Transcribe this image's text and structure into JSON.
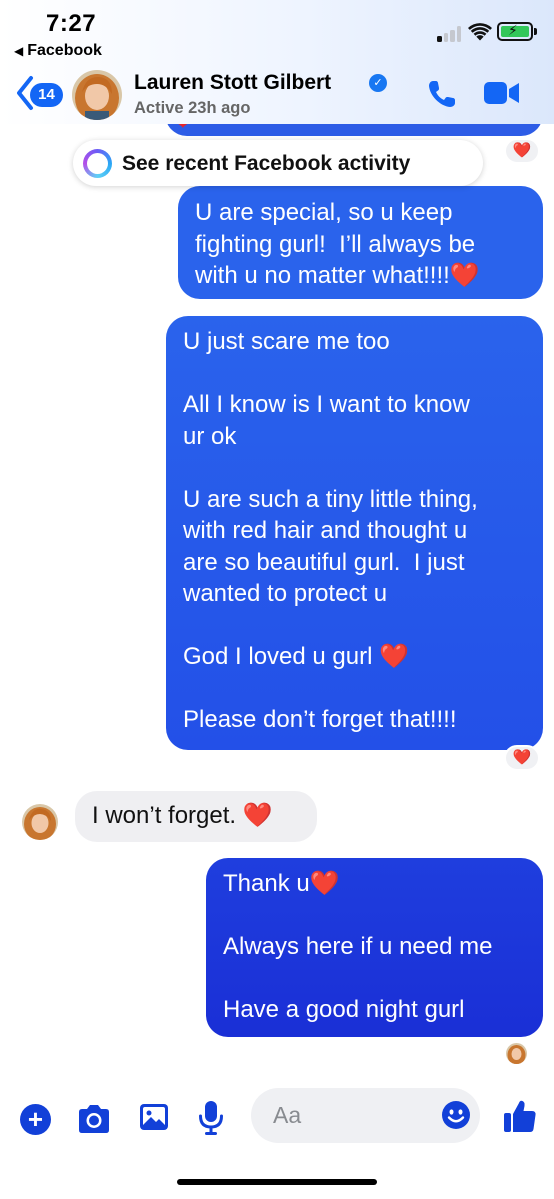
{
  "status_bar": {
    "time": "7:27",
    "back_app": "Facebook"
  },
  "header": {
    "unread_count": "14",
    "contact_name": "Lauren Stott Gilbert",
    "active_status": "Active 23h ago"
  },
  "banner": {
    "label": "See recent Facebook activity"
  },
  "messages": [
    {
      "direction": "sent",
      "lines": [
        "U are special, so u keep",
        "fighting gurl!  I’ll always be",
        "with u no matter what!!!!❤️"
      ],
      "reaction": "❤️"
    },
    {
      "direction": "sent",
      "lines": [
        "U just scare me too",
        "",
        "All I know is I want to know",
        "ur ok",
        "",
        "U are such a tiny little thing,",
        "with red hair and thought u",
        "are so beautiful gurl.  I just",
        "wanted to protect u",
        "",
        "God I loved u gurl ❤️",
        "",
        "Please don’t forget that!!!!"
      ],
      "reaction": "❤️"
    },
    {
      "direction": "received",
      "lines": [
        "I won’t forget. ❤️"
      ]
    },
    {
      "direction": "sent",
      "lines": [
        "Thank u❤️",
        "",
        "Always here if u need me",
        "",
        "Have a good night gurl"
      ]
    }
  ],
  "composer": {
    "placeholder": "Aa"
  },
  "colors": {
    "accent": "#1366f5",
    "sent_bubble_top": "#2a63ec",
    "sent_bubble_bottom": "#1a2fd6",
    "received_bubble": "#efeff2",
    "reaction_heart": "#e3262e"
  },
  "icons": {
    "header": [
      "back-chevron-icon",
      "verified-badge-icon",
      "phone-icon",
      "video-camera-icon"
    ],
    "composer": [
      "plus-icon",
      "camera-icon",
      "photo-gallery-icon",
      "microphone-icon",
      "emoji-icon",
      "thumbs-up-icon"
    ]
  }
}
